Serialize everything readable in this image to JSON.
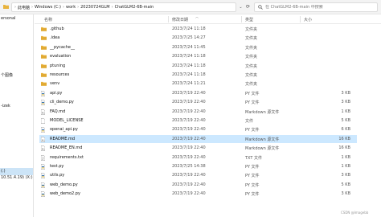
{
  "address_bar": {
    "crumbs": [
      "此电脑",
      "Windows (C:)",
      "work",
      "20230724GLM",
      "ChatGLM2-6B-main"
    ],
    "search_placeholder": "在 ChatGLM2-6B-main 中搜索"
  },
  "sidebar": {
    "items": [
      "ersonal",
      "",
      "",
      "",
      "",
      "",
      "个图像",
      "",
      "",
      "",
      "-izek",
      "",
      "",
      "",
      "",
      "",
      "",
      "",
      "",
      "(:)",
      "10.51.4.19) (X:)",
      ""
    ]
  },
  "columns": {
    "name": "名称",
    "date": "修改日期",
    "type": "类型",
    "size": "大小"
  },
  "files": [
    {
      "name": ".github",
      "date": "2023/7/24 11:18",
      "type": "文件夹",
      "size": "",
      "kind": "folder"
    },
    {
      "name": ".idea",
      "date": "2023/7/25 14:27",
      "type": "文件夹",
      "size": "",
      "kind": "folder"
    },
    {
      "name": "__pycache__",
      "date": "2023/7/24 11:45",
      "type": "文件夹",
      "size": "",
      "kind": "folder"
    },
    {
      "name": "evaluation",
      "date": "2023/7/24 11:18",
      "type": "文件夹",
      "size": "",
      "kind": "folder"
    },
    {
      "name": "ptuning",
      "date": "2023/7/24 11:18",
      "type": "文件夹",
      "size": "",
      "kind": "folder"
    },
    {
      "name": "resources",
      "date": "2023/7/24 11:18",
      "type": "文件夹",
      "size": "",
      "kind": "folder"
    },
    {
      "name": "venv",
      "date": "2023/7/24 11:21",
      "type": "文件夹",
      "size": "",
      "kind": "folder"
    },
    {
      "name": "api.py",
      "date": "2023/7/19 22:40",
      "type": "PY 文件",
      "size": "3 KB",
      "kind": "py"
    },
    {
      "name": "cli_demo.py",
      "date": "2023/7/19 22:40",
      "type": "PY 文件",
      "size": "3 KB",
      "kind": "py"
    },
    {
      "name": "FAQ.md",
      "date": "2023/7/19 22:40",
      "type": "Markdown 源文件",
      "size": "1 KB",
      "kind": "md"
    },
    {
      "name": "MODEL_LICENSE",
      "date": "2023/7/19 22:40",
      "type": "文件",
      "size": "5 KB",
      "kind": "file"
    },
    {
      "name": "openai_api.py",
      "date": "2023/7/19 22:40",
      "type": "PY 文件",
      "size": "6 KB",
      "kind": "py"
    },
    {
      "name": "README.md",
      "date": "2023/7/19 22:40",
      "type": "Markdown 源文件",
      "size": "16 KB",
      "kind": "md",
      "selected": true
    },
    {
      "name": "README_EN.md",
      "date": "2023/7/19 22:40",
      "type": "Markdown 源文件",
      "size": "16 KB",
      "kind": "md"
    },
    {
      "name": "requirements.txt",
      "date": "2023/7/19 22:40",
      "type": "TXT 文件",
      "size": "1 KB",
      "kind": "txt"
    },
    {
      "name": "test.py",
      "date": "2023/7/25 14:38",
      "type": "PY 文件",
      "size": "1 KB",
      "kind": "py"
    },
    {
      "name": "utils.py",
      "date": "2023/7/19 22:40",
      "type": "PY 文件",
      "size": "3 KB",
      "kind": "py"
    },
    {
      "name": "web_demo.py",
      "date": "2023/7/19 22:40",
      "type": "PY 文件",
      "size": "5 KB",
      "kind": "py"
    },
    {
      "name": "web_demo2.py",
      "date": "2023/7/19 22:40",
      "type": "PY 文件",
      "size": "3 KB",
      "kind": "py"
    }
  ],
  "watermark": "CSDN @Imagebb",
  "colors": {
    "folder": "#e8b33e",
    "folder_dark": "#d49a1f",
    "py": "#3a75b0",
    "md": "#555555",
    "selection": "#cce8ff"
  }
}
